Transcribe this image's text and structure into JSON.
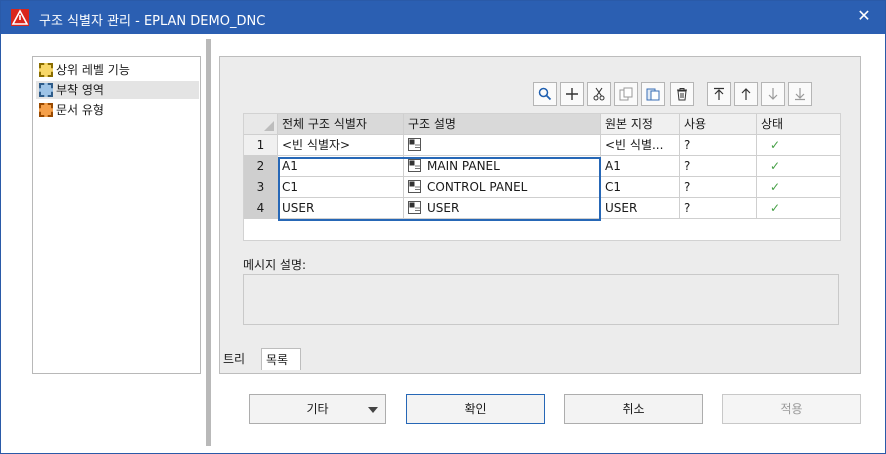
{
  "window": {
    "title": "구조 식별자 관리 - EPLAN DEMO_DNC"
  },
  "tree": {
    "items": [
      {
        "label": "상위 레벨 기능",
        "icon": "function-level-icon",
        "color": "#e8b400"
      },
      {
        "label": "부착 영역",
        "icon": "mounting-location-icon",
        "color": "#5b9bd5"
      },
      {
        "label": "문서 유형",
        "icon": "document-type-icon",
        "color": "#f07800"
      }
    ]
  },
  "toolbar": {
    "buttons": [
      {
        "name": "search-icon",
        "glyph": "⌕"
      },
      {
        "name": "plus-icon",
        "glyph": "+"
      },
      {
        "name": "cut-icon",
        "glyph": "✂"
      },
      {
        "name": "copy-icon",
        "glyph": "❐"
      },
      {
        "name": "paste-icon",
        "glyph": "▤"
      },
      {
        "name": "delete-icon",
        "glyph": "🗑"
      },
      {
        "name": "move-top-icon",
        "glyph": "⤒"
      },
      {
        "name": "move-up-icon",
        "glyph": "↑"
      },
      {
        "name": "move-down-icon",
        "glyph": "↓"
      },
      {
        "name": "move-bottom-icon",
        "glyph": "⤓"
      }
    ]
  },
  "grid": {
    "headers": [
      "전체 구조 식별자",
      "구조 설명",
      "원본 지정",
      "사용",
      "상태"
    ],
    "rows": [
      {
        "num": "1",
        "full_id": "<빈 식별자>",
        "desc": "",
        "source": "<빈 식별...",
        "use": "?",
        "status": "✓"
      },
      {
        "num": "2",
        "full_id": "A1",
        "desc": "MAIN PANEL",
        "source": "A1",
        "use": "?",
        "status": "✓"
      },
      {
        "num": "3",
        "full_id": "C1",
        "desc": "CONTROL PANEL",
        "source": "C1",
        "use": "?",
        "status": "✓"
      },
      {
        "num": "4",
        "full_id": "USER",
        "desc": "USER",
        "source": "USER",
        "use": "?",
        "status": "✓"
      }
    ]
  },
  "message": {
    "label": "메시지 설명:",
    "value": ""
  },
  "tabs": [
    {
      "label": "트리"
    },
    {
      "label": "목록"
    }
  ],
  "buttons": {
    "other": "기타",
    "ok": "확인",
    "cancel": "취소",
    "apply": "적용"
  },
  "colors": {
    "titlebar": "#2b5fb2",
    "selection_border": "#2667b6",
    "check": "#46a046"
  }
}
